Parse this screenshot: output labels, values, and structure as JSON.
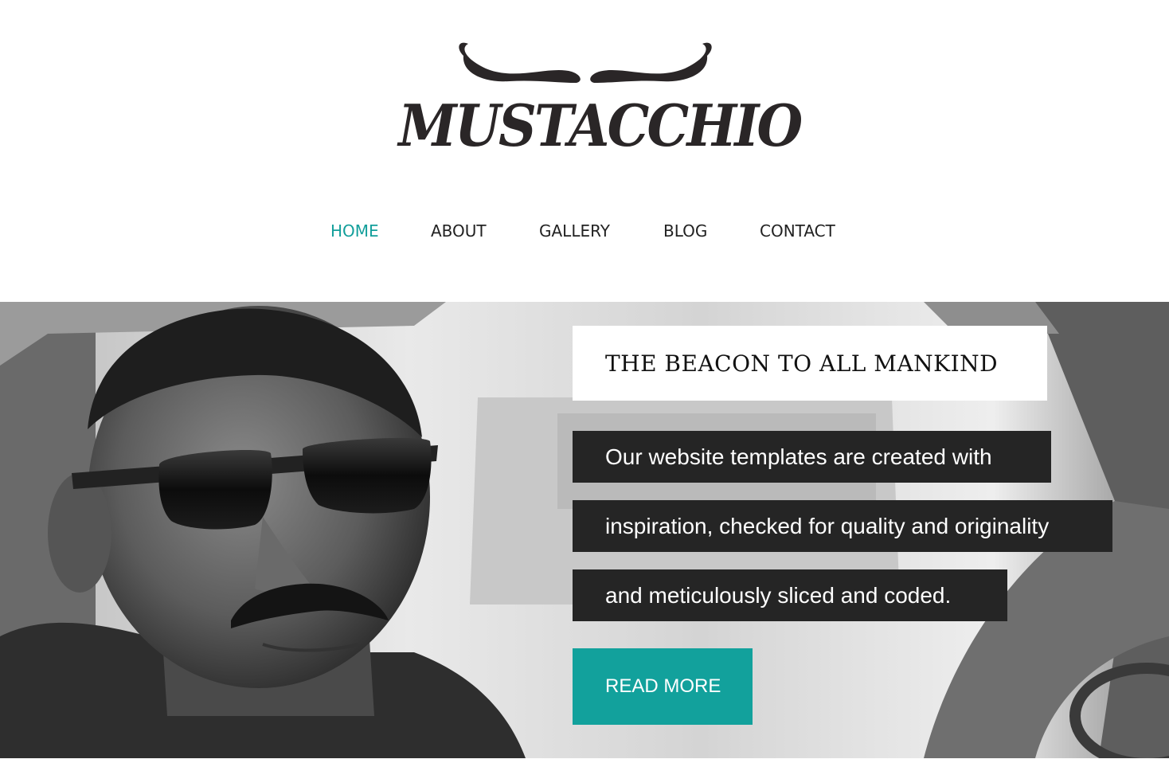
{
  "brand": {
    "logo_text": "MUSTACCHIO",
    "logo_icon": "mustache-icon"
  },
  "nav": {
    "items": [
      {
        "label": "HOME",
        "active": true
      },
      {
        "label": "ABOUT",
        "active": false
      },
      {
        "label": "GALLERY",
        "active": false
      },
      {
        "label": "BLOG",
        "active": false
      },
      {
        "label": "CONTACT",
        "active": false
      }
    ]
  },
  "hero": {
    "headline": "THE BEACON TO ALL MANKIND",
    "description_lines": [
      "Our website templates are created with",
      "inspiration, checked for quality and originality",
      "and meticulously sliced and coded."
    ],
    "cta_label": "READ MORE"
  },
  "colors": {
    "accent": "#139f9b",
    "text_dark": "#222222",
    "caption_bg": "#252525",
    "button_bg": "#12a19c"
  }
}
